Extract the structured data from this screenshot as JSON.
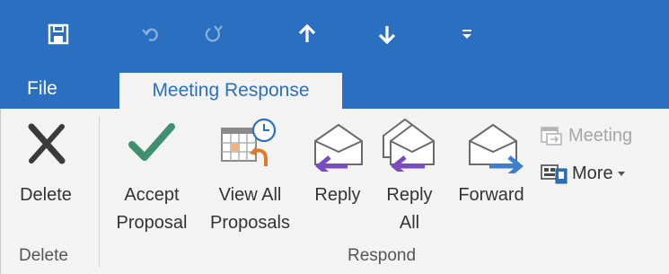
{
  "tabs": {
    "file": "File",
    "active": "Meeting Response"
  },
  "ribbon": {
    "delete_group": {
      "delete": "Delete",
      "group_label": "Delete"
    },
    "respond_group": {
      "accept_line1": "Accept",
      "accept_line2": "Proposal",
      "viewall_line1": "View All",
      "viewall_line2": "Proposals",
      "reply": "Reply",
      "replyall_line1": "Reply",
      "replyall_line2": "All",
      "forward": "Forward",
      "meeting": "Meeting",
      "more": "More",
      "group_label": "Respond"
    }
  },
  "colors": {
    "brand_blue": "#2b6fc0",
    "ribbon_bg": "#f3f3f3",
    "check_green": "#3f8f72",
    "arrow_purple": "#7a4cc0",
    "arrow_blue": "#3c7fd0",
    "clock_orange": "#e07a24"
  },
  "icons": [
    "save-icon",
    "undo-icon",
    "redo-icon",
    "up-arrow-icon",
    "down-arrow-icon",
    "customize-qat-icon",
    "delete-x-icon",
    "checkmark-icon",
    "calendar-clock-icon",
    "reply-envelope-icon",
    "reply-all-envelope-icon",
    "forward-envelope-icon",
    "meeting-icon",
    "more-icon"
  ]
}
